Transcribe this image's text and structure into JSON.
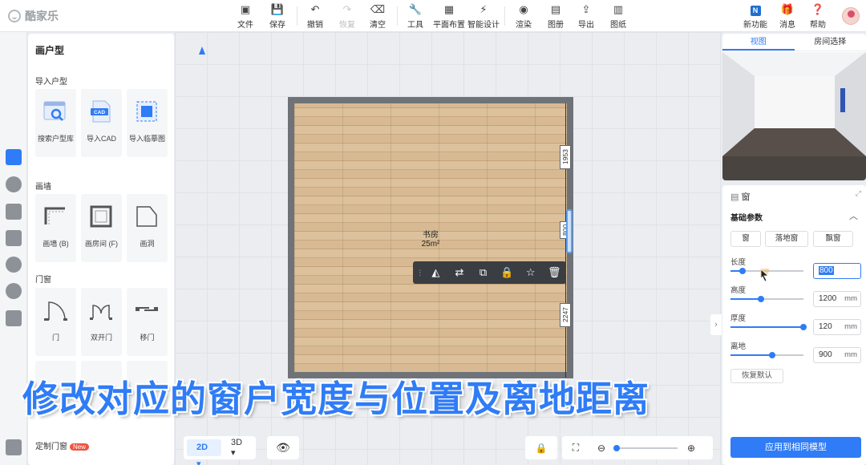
{
  "app": {
    "name": "酷家乐"
  },
  "toolbar": {
    "file": "文件",
    "save": "保存",
    "undo": "撤销",
    "redo": "恢复",
    "clear": "清空",
    "tools": "工具",
    "floorplan": "平面布置",
    "smart": "智能设计",
    "render": "渲染",
    "album": "图册",
    "export": "导出",
    "drawing": "图纸",
    "new_feature": "新功能",
    "messages": "消息",
    "help": "帮助",
    "new_badge": "N"
  },
  "left_panel": {
    "title": "画户型",
    "import_section": "导入户型",
    "import_items": [
      "搜索户型库",
      "导入CAD",
      "导入临摹图"
    ],
    "cad_tag": "CAD",
    "wall_section": "画墙",
    "wall_items": [
      "画墙 (B)",
      "画房间 (F)",
      "画洞"
    ],
    "door_section": "门窗",
    "door_items": [
      "门",
      "双开门",
      "移门"
    ],
    "custom_section": "定制门窗",
    "new_tag": "New"
  },
  "canvas": {
    "room_name": "书房",
    "room_area": "25m²",
    "dim_top": "1953",
    "dim_window": "800",
    "dim_bottom": "2247",
    "view_2d": "2D",
    "view_3d": "3D"
  },
  "view_panel": {
    "tab_view": "视图",
    "tab_room": "房间选择"
  },
  "props": {
    "header": "窗",
    "section": "基础参数",
    "types": [
      "窗",
      "落地窗",
      "飘窗"
    ],
    "length_label": "长度",
    "length": "800",
    "height_label": "高度",
    "height": "1200",
    "height_level": 0.42,
    "thickness_label": "厚度",
    "thickness": "120",
    "thickness_level": 1.0,
    "offground_label": "离地",
    "offground": "900",
    "offground_level": 0.57,
    "length_level": 0.16,
    "unit": "mm",
    "restore": "恢复默认",
    "apply": "应用到相同模型"
  },
  "caption": "修改对应的窗户宽度与位置及离地距离",
  "colors": {
    "accent": "#2f7cf6",
    "floor": "#d2b48c",
    "wall": "#6f7378"
  }
}
